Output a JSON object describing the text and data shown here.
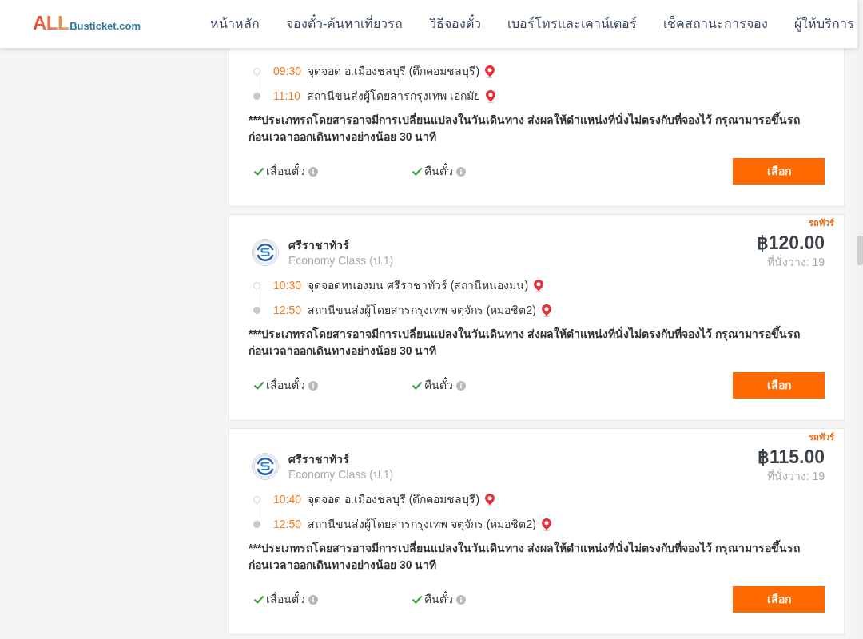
{
  "header": {
    "logo": {
      "mark": "ALL",
      "name": "Busticket.com"
    },
    "nav": [
      "หน้าหลัก",
      "จองตั๋ว-ค้นหาเที่ยวรถ",
      "วิธีจองตั๋ว",
      "เบอร์โทรและเคาน์เตอร์",
      "เช็คสถานะการจอง",
      "ผู้ให้บริการ"
    ]
  },
  "trips": [
    {
      "stops": [
        {
          "kind": "departure",
          "time": "09:30",
          "place": "จุดจอด อ.เมืองชลบุรี (ตึกคอมชลบุรี)"
        },
        {
          "kind": "arrival",
          "time": "11:10",
          "place": "สถานีขนส่งผู้โดยสารกรุงเทพ เอกมัย"
        }
      ],
      "notice": "***ประเภทรถโดยสารอาจมีการเปลี่ยนแปลงในวันเดินทาง ส่งผลให้ตำแหน่งที่นั่งไม่ตรงกับที่จองไว้ กรุณามารอขึ้นรถก่อนเวลาออกเดินทางอย่างน้อย 30 นาที",
      "features": [
        {
          "label": "เลื่อนตั๋ว",
          "available": true
        },
        {
          "label": "คืนตั๋ว",
          "available": true
        }
      ],
      "button": "เลือก"
    },
    {
      "badge": "รถทัวร์",
      "operator": "ศรีราชาทัวร์",
      "bus_class": "Economy Class (ป.1)",
      "price": "฿120.00",
      "seats": "ที่นั่งว่าง: 19",
      "stops": [
        {
          "kind": "departure",
          "time": "10:30",
          "place": "จุดจอดหนองมน ศรีราชาทัวร์ (สถานีหนองมน)"
        },
        {
          "kind": "arrival",
          "time": "12:50",
          "place": "สถานีขนส่งผู้โดยสารกรุงเทพ จตุจักร (หมอชิต2)"
        }
      ],
      "notice": "***ประเภทรถโดยสารอาจมีการเปลี่ยนแปลงในวันเดินทาง ส่งผลให้ตำแหน่งที่นั่งไม่ตรงกับที่จองไว้ กรุณามารอขึ้นรถก่อนเวลาออกเดินทางอย่างน้อย 30 นาที",
      "features": [
        {
          "label": "เลื่อนตั๋ว",
          "available": true
        },
        {
          "label": "คืนตั๋ว",
          "available": true
        }
      ],
      "button": "เลือก"
    },
    {
      "badge": "รถทัวร์",
      "operator": "ศรีราชาทัวร์",
      "bus_class": "Economy Class (ป.1)",
      "price": "฿115.00",
      "seats": "ที่นั่งว่าง: 19",
      "stops": [
        {
          "kind": "departure",
          "time": "10:40",
          "place": "จุดจอด อ.เมืองชลบุรี (ตึกคอมชลบุรี)"
        },
        {
          "kind": "arrival",
          "time": "12:50",
          "place": "สถานีขนส่งผู้โดยสารกรุงเทพ จตุจักร (หมอชิต2)"
        }
      ],
      "notice": "***ประเภทรถโดยสารอาจมีการเปลี่ยนแปลงในวันเดินทาง ส่งผลให้ตำแหน่งที่นั่งไม่ตรงกับที่จองไว้ กรุณามารอขึ้นรถก่อนเวลาออกเดินทางอย่างน้อย 30 นาที",
      "features": [
        {
          "label": "เลื่อนตั๋ว",
          "available": true
        },
        {
          "label": "คืนตั๋ว",
          "available": true
        }
      ],
      "button": "เลือก"
    }
  ]
}
